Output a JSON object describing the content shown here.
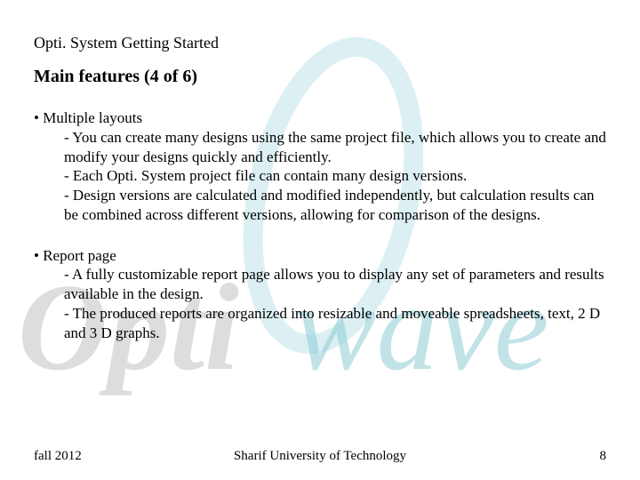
{
  "header": "Opti. System Getting Started",
  "title": "Main features (4 of 6)",
  "bullets": [
    {
      "head": "• Multiple layouts",
      "subs": [
        "- You can create many designs using the same project file, which allows you to create and modify your designs quickly and efficiently.",
        "- Each Opti. System project file can contain many design versions.",
        "- Design versions are calculated and modified independently, but calculation results can be combined across different versions, allowing for comparison of the designs."
      ]
    },
    {
      "head": "• Report page",
      "subs": [
        "- A fully customizable report page allows you to display any set of parameters and results available in the design.",
        "- The produced reports are organized into resizable and moveable spreadsheets, text, 2 D and 3 D graphs."
      ]
    }
  ],
  "footer": {
    "left": "fall 2012",
    "center": "Sharif University of Technology",
    "right": "8"
  }
}
